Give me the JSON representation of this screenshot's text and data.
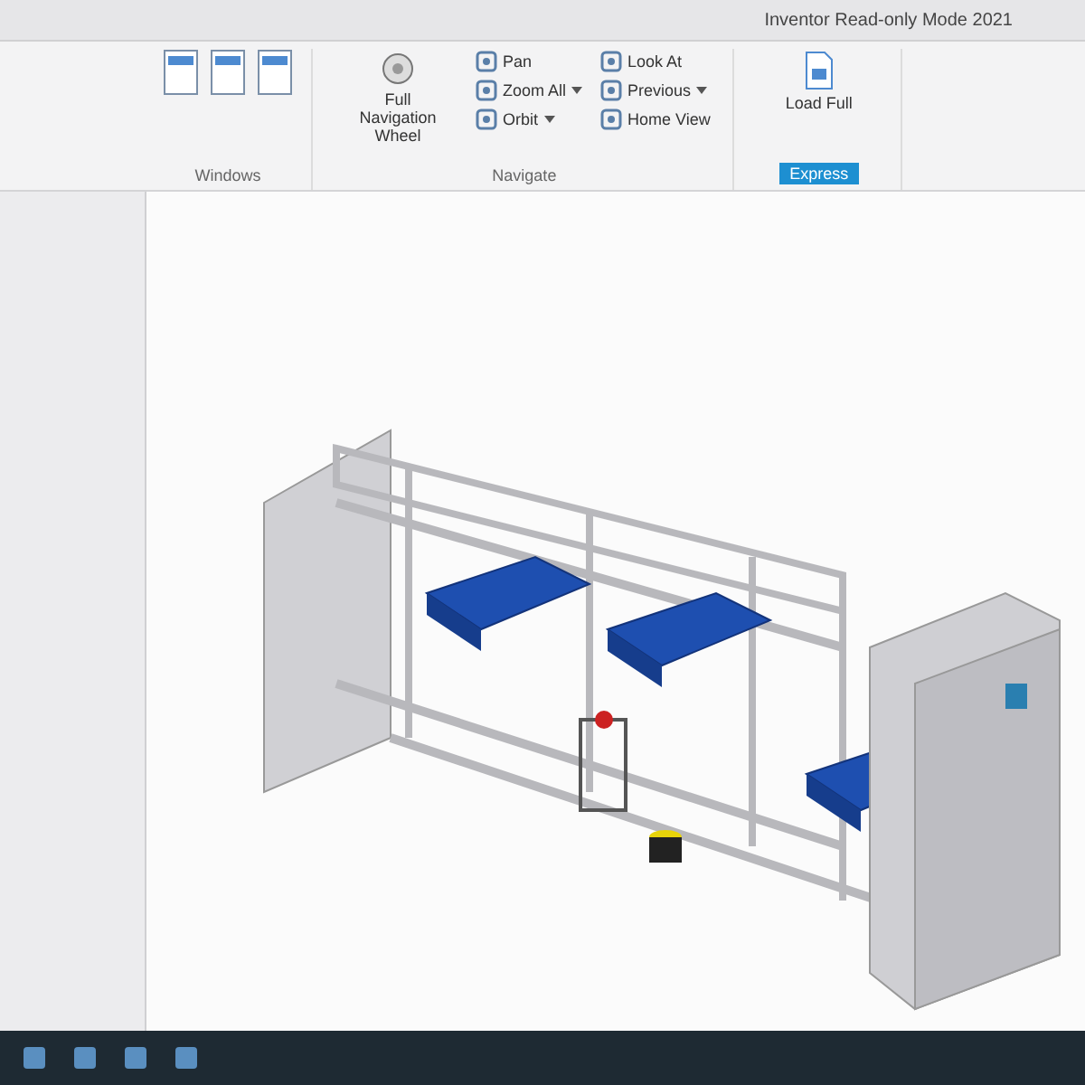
{
  "window": {
    "title": "Inventor Read-only Mode 2021"
  },
  "ribbon": {
    "groups": [
      {
        "label": "Windows",
        "kind": "icons"
      },
      {
        "label": "Navigate",
        "kind": "navigate",
        "wheel": "Full Navigation Wheel",
        "tools": [
          {
            "label": "Pan",
            "dropdown": false
          },
          {
            "label": "Zoom All",
            "dropdown": true
          },
          {
            "label": "Orbit",
            "dropdown": true
          },
          {
            "label": "Look At",
            "dropdown": false
          },
          {
            "label": "Previous",
            "dropdown": true
          },
          {
            "label": "Home View",
            "dropdown": false
          }
        ]
      },
      {
        "label": "Express",
        "kind": "express",
        "tools": [
          {
            "label": "Load Full"
          }
        ]
      }
    ]
  }
}
